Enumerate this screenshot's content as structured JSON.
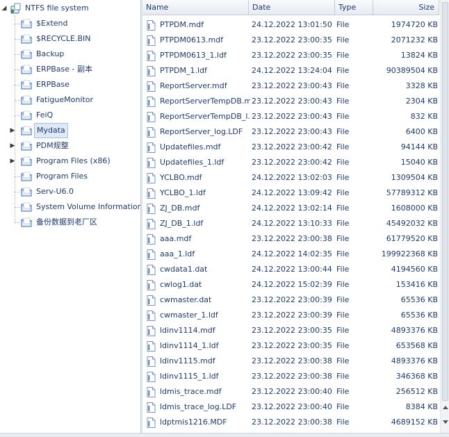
{
  "tree": {
    "root": {
      "label": "NTFS file system",
      "icon": "drive-icon"
    },
    "folders": [
      {
        "label": "$Extend",
        "expandable": false
      },
      {
        "label": "$RECYCLE.BIN",
        "expandable": false
      },
      {
        "label": "Backup",
        "expandable": false
      },
      {
        "label": "ERPBase - 副本",
        "expandable": false
      },
      {
        "label": "ERPBase",
        "expandable": false
      },
      {
        "label": "FatigueMonitor",
        "expandable": false
      },
      {
        "label": "FeiQ",
        "expandable": false
      },
      {
        "label": "Mydata",
        "expandable": true,
        "selected": true
      },
      {
        "label": "PDM规整",
        "expandable": true
      },
      {
        "label": "Program Files (x86)",
        "expandable": true
      },
      {
        "label": "Program Files",
        "expandable": false
      },
      {
        "label": "Serv-U6.0",
        "expandable": false
      },
      {
        "label": "System Volume Information",
        "expandable": false
      },
      {
        "label": "备份数据到老厂区",
        "expandable": false
      }
    ]
  },
  "list": {
    "columns": {
      "name": "Name",
      "date": "Date",
      "type": "Type",
      "size": "Size"
    },
    "rows": [
      {
        "name": "PTPDM.mdf",
        "date": "24.12.2022 13:01:50",
        "type": "File",
        "size": "1974720 KB"
      },
      {
        "name": "PTPDM0613.mdf",
        "date": "23.12.2022 23:00:35",
        "type": "File",
        "size": "2071232 KB"
      },
      {
        "name": "PTPDM0613_1.ldf",
        "date": "23.12.2022 23:00:35",
        "type": "File",
        "size": "13824 KB"
      },
      {
        "name": "PTPDM_1.ldf",
        "date": "24.12.2022 13:24:04",
        "type": "File",
        "size": "90389504 KB"
      },
      {
        "name": "ReportServer.mdf",
        "date": "23.12.2022 23:00:43",
        "type": "File",
        "size": "3328 KB"
      },
      {
        "name": "ReportServerTempDB.mdf",
        "date": "23.12.2022 23:00:43",
        "type": "File",
        "size": "2304 KB"
      },
      {
        "name": "ReportServerTempDB_l...",
        "date": "23.12.2022 23:00:43",
        "type": "File",
        "size": "832 KB"
      },
      {
        "name": "ReportServer_log.LDF",
        "date": "23.12.2022 23:00:43",
        "type": "File",
        "size": "6400 KB"
      },
      {
        "name": "Updatefiles.mdf",
        "date": "23.12.2022 23:00:42",
        "type": "File",
        "size": "94144 KB"
      },
      {
        "name": "Updatefiles_1.ldf",
        "date": "23.12.2022 23:00:42",
        "type": "File",
        "size": "15040 KB"
      },
      {
        "name": "YCLBO.mdf",
        "date": "24.12.2022 13:02:03",
        "type": "File",
        "size": "1309504 KB"
      },
      {
        "name": "YCLBO_1.ldf",
        "date": "24.12.2022 13:09:42",
        "type": "File",
        "size": "57789312 KB"
      },
      {
        "name": "ZJ_DB.mdf",
        "date": "24.12.2022 13:02:14",
        "type": "File",
        "size": "1608000 KB"
      },
      {
        "name": "ZJ_DB_1.ldf",
        "date": "24.12.2022 13:10:33",
        "type": "File",
        "size": "45492032 KB"
      },
      {
        "name": "aaa.mdf",
        "date": "23.12.2022 23:00:38",
        "type": "File",
        "size": "61779520 KB"
      },
      {
        "name": "aaa_1.ldf",
        "date": "24.12.2022 14:02:35",
        "type": "File",
        "size": "199922368 KB"
      },
      {
        "name": "cwdata1.dat",
        "date": "24.12.2022 13:00:44",
        "type": "File",
        "size": "4194560 KB"
      },
      {
        "name": "cwlog1.dat",
        "date": "24.12.2022 15:02:39",
        "type": "File",
        "size": "153416 KB"
      },
      {
        "name": "cwmaster.dat",
        "date": "23.12.2022 23:00:39",
        "type": "File",
        "size": "65536 KB"
      },
      {
        "name": "cwmaster_1.ldf",
        "date": "23.12.2022 23:00:39",
        "type": "File",
        "size": "65536 KB"
      },
      {
        "name": "ldinv1114.mdf",
        "date": "23.12.2022 23:00:35",
        "type": "File",
        "size": "4893376 KB"
      },
      {
        "name": "ldinv1114_1.ldf",
        "date": "23.12.2022 23:00:35",
        "type": "File",
        "size": "653568 KB"
      },
      {
        "name": "ldinv1115.mdf",
        "date": "23.12.2022 23:00:38",
        "type": "File",
        "size": "4893376 KB"
      },
      {
        "name": "ldinv1115_1.ldf",
        "date": "23.12.2022 23:00:38",
        "type": "File",
        "size": "346368 KB"
      },
      {
        "name": "ldmis_trace.mdf",
        "date": "23.12.2022 23:00:40",
        "type": "File",
        "size": "256512 KB"
      },
      {
        "name": "ldmis_trace_log.LDF",
        "date": "23.12.2022 23:00:40",
        "type": "File",
        "size": "8384 KB"
      },
      {
        "name": "ldptmis1216.MDF",
        "date": "23.12.2022 23:00:38",
        "type": "File",
        "size": "4689152 KB"
      }
    ]
  }
}
